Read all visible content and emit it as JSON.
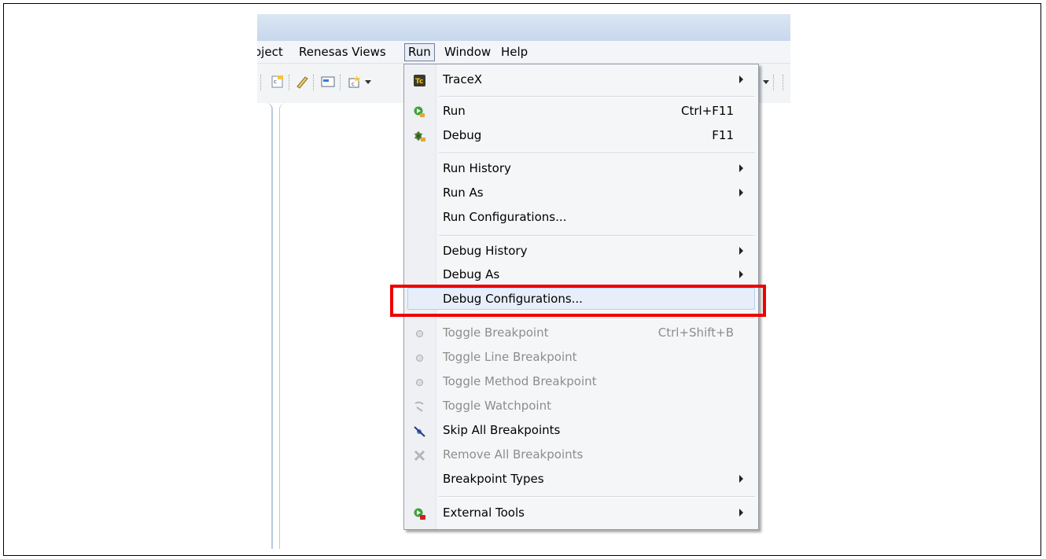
{
  "menubar": [
    "oject",
    "Renesas Views",
    "Run",
    "Window",
    "Help"
  ],
  "run_menu": {
    "tracex": "TraceX",
    "run": "Run",
    "run_shortcut": "Ctrl+F11",
    "debug": "Debug",
    "debug_shortcut": "F11",
    "run_history": "Run History",
    "run_as": "Run As",
    "run_configurations": "Run Configurations...",
    "debug_history": "Debug History",
    "debug_as": "Debug As",
    "debug_configurations": "Debug Configurations...",
    "toggle_breakpoint": "Toggle Breakpoint",
    "toggle_breakpoint_shortcut": "Ctrl+Shift+B",
    "toggle_line_breakpoint": "Toggle Line Breakpoint",
    "toggle_method_breakpoint": "Toggle Method Breakpoint",
    "toggle_watchpoint": "Toggle Watchpoint",
    "skip_all_breakpoints": "Skip All Breakpoints",
    "remove_all_breakpoints": "Remove All Breakpoints",
    "breakpoint_types": "Breakpoint Types",
    "external_tools": "External Tools"
  },
  "colors": {
    "annotation": "#ee0000",
    "menu_background": "#f5f6f8",
    "highlight": "#e7eefa",
    "disabled_text": "#8d8d8d"
  },
  "icons": [
    "tracex-icon",
    "run-icon",
    "debug-icon",
    "breakpoint-icon",
    "watchpoint-icon",
    "skip-breakpoints-icon",
    "remove-breakpoints-icon",
    "external-tools-icon"
  ]
}
